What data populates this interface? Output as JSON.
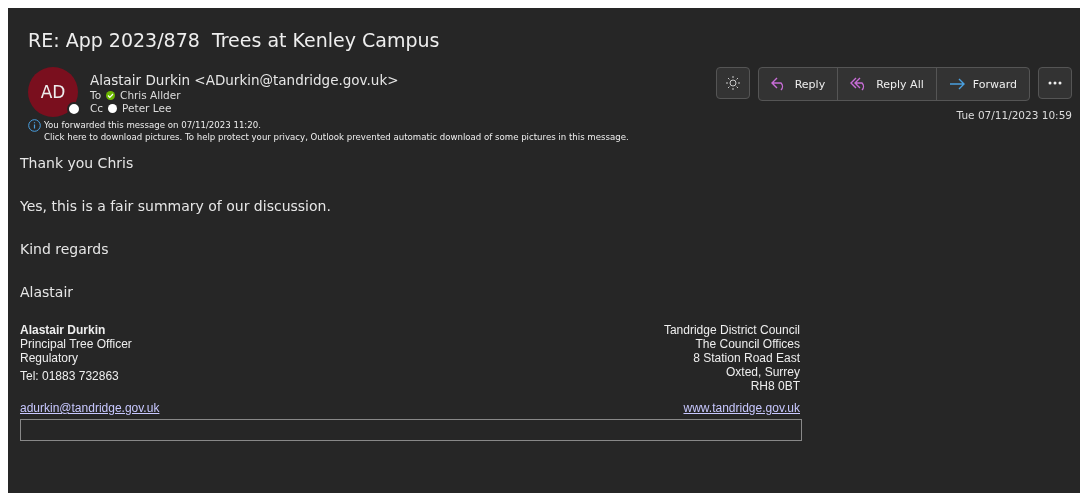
{
  "subject": "RE: App 2023/878  Trees at Kenley Campus",
  "sender": {
    "initials": "AD",
    "name": "Alastair Durkin <ADurkin@tandridge.gov.uk>"
  },
  "recipients": [
    {
      "label": "To",
      "name": "Chris Allder",
      "kind": "available",
      "color": "#6bb700"
    },
    {
      "label": "Cc",
      "name": "Peter Lee",
      "kind": "unknown",
      "color": "#ffffff"
    }
  ],
  "actions": [
    {
      "label": "Reply",
      "kind": "reply"
    },
    {
      "label": "Reply All",
      "kind": "reply-all"
    },
    {
      "label": "Forward",
      "kind": "forward"
    }
  ],
  "date": "Tue 07/11/2023 10:59",
  "info": [
    "You forwarded this message on 07/11/2023 11:20.",
    "Click here to download pictures. To help protect your privacy, Outlook prevented automatic download of some pictures in this message."
  ],
  "body": [
    "Thank you Chris",
    "Yes, this is a fair summary of our discussion.",
    "Kind regards",
    "Alastair"
  ],
  "signature": {
    "name": "Alastair Durkin",
    "lines": [
      "Principal Tree Officer",
      "Regulatory"
    ],
    "tel": "Tel: 01883 732863",
    "email": "adurkin@tandridge.gov.uk",
    "address": [
      "Tandridge District Council",
      "The Council Offices",
      "8 Station Road East",
      "Oxted, Surrey",
      "RH8 0BT"
    ],
    "website": "www.tandridge.gov.uk"
  }
}
